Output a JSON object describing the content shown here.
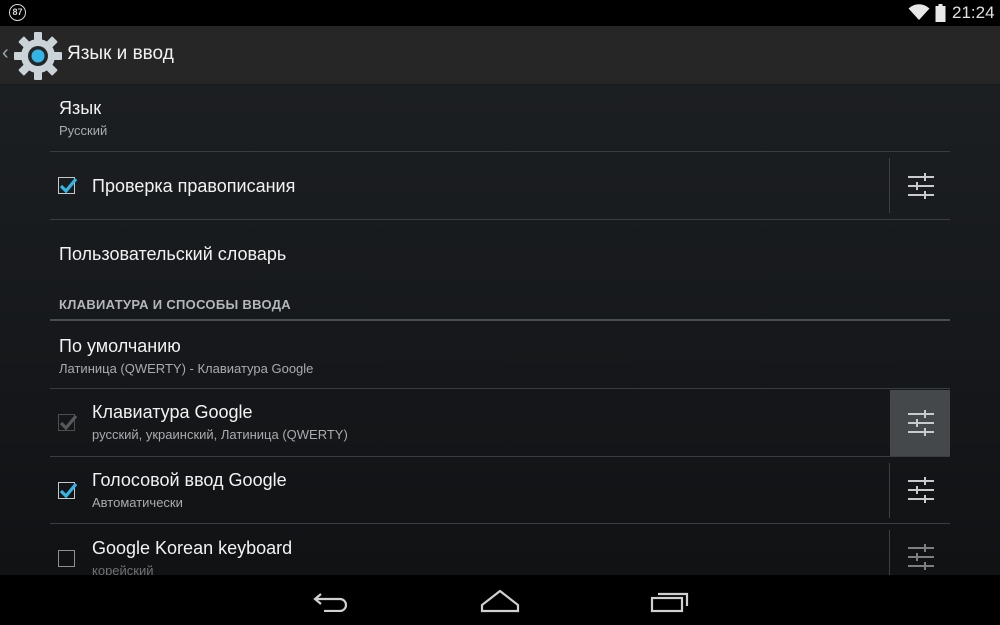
{
  "status_bar": {
    "notification_count": "87",
    "time": "21:24",
    "icons": [
      "wifi-icon",
      "battery-icon"
    ]
  },
  "action_bar": {
    "title": "Язык и ввод",
    "icon": "settings-gear-icon"
  },
  "language": {
    "title": "Язык",
    "summary": "Русский"
  },
  "spell_check": {
    "title": "Проверка правописания",
    "checked": true
  },
  "user_dictionary": {
    "title": "Пользовательский словарь"
  },
  "keyboard_section": {
    "header": "КЛАВИАТУРА И СПОСОБЫ ВВОДА"
  },
  "default_input": {
    "title": "По умолчанию",
    "summary": "Латиница (QWERTY) - Клавиатура Google"
  },
  "input_methods": [
    {
      "title": "Клавиатура Google",
      "summary": "русский, украинский, Латиница (QWERTY)",
      "checked": true,
      "enabled": false
    },
    {
      "title": "Голосовой ввод Google",
      "summary": "Автоматически",
      "checked": true,
      "enabled": true
    },
    {
      "title": "Google Korean keyboard",
      "summary": "корейский",
      "checked": false,
      "enabled": true
    }
  ],
  "nav_bar": {
    "buttons": [
      "back-icon",
      "home-icon",
      "recents-icon"
    ]
  },
  "colors": {
    "accent": "#33b5e5",
    "action_bar": "#262626",
    "background": "#1c1f22"
  }
}
